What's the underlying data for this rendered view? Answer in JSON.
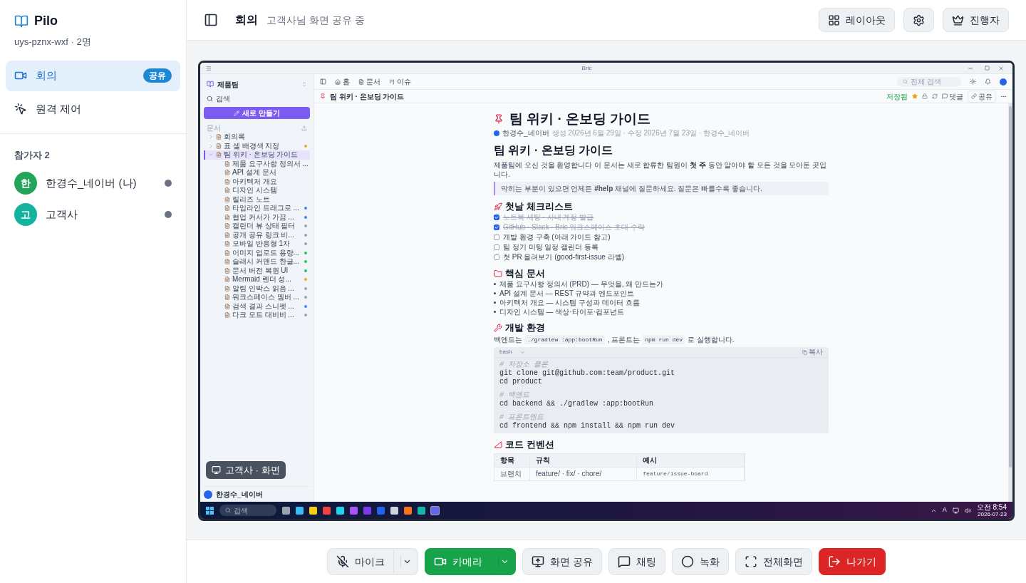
{
  "app": {
    "name": "Pilo",
    "room": "uys-pznx-wxf · 2명"
  },
  "nav": [
    {
      "kind": "meeting",
      "label": "회의",
      "selected": true,
      "badge": "공유"
    },
    {
      "kind": "remote",
      "label": "원격 제어",
      "selected": false
    }
  ],
  "participants": {
    "title": "참가자 2",
    "items": [
      {
        "initial": "한",
        "name": "한경수_네이버 (나)",
        "color": "#22a55a"
      },
      {
        "initial": "고",
        "name": "고객사",
        "color": "#14b3a0"
      }
    ]
  },
  "header": {
    "title": "회의",
    "subtitle": "고객사님 화면 공유 중",
    "buttons": [
      {
        "kind": "layout",
        "label": "레이아웃"
      },
      {
        "kind": "settings"
      },
      {
        "kind": "host",
        "label": "진행자"
      }
    ]
  },
  "share": {
    "label": "고객사 · 화면",
    "screen": {
      "window_title": "Bric",
      "toolbar": [
        {
          "kind": "home",
          "label": "홈"
        },
        {
          "kind": "docs",
          "label": "문서"
        },
        {
          "kind": "issues",
          "label": "이슈"
        }
      ],
      "search_placeholder": "전체 검색",
      "doc_header": {
        "title": "팀 위키 · 온보딩 가이드",
        "status": "저장됨",
        "comment": "댓글",
        "share": "공유"
      },
      "sidebar": {
        "workspace": "제품팀",
        "search": "검색",
        "new_button": "새로 만들기",
        "section": "문서",
        "user": "한경수_네이버",
        "tree": [
          {
            "label": "회의록",
            "selected": false,
            "expanded": false
          },
          {
            "label": "표 셀 배경색 지정",
            "selected": false,
            "expanded": false,
            "color": "#f5a524"
          },
          {
            "label": "팀 위키 · 온보딩 가이드",
            "selected": true,
            "expanded": true,
            "children": [
              {
                "label": "제품 요구사항 정의서 ..."
              },
              {
                "label": "API 설계 문서"
              },
              {
                "label": "아키텍처 개요"
              },
              {
                "label": "디자인 시스템"
              },
              {
                "label": "릴리즈 노트"
              },
              {
                "label": "타임라인 드래그로 ...",
                "color": "#3b82f6"
              },
              {
                "label": "협업 커서가 가끔 ...",
                "color": "#3b82f6"
              },
              {
                "label": "캘린더 뷰 상태 필터",
                "color": "#9ca3af"
              },
              {
                "label": "공개 공유 링크 비...",
                "color": "#9ca3af"
              },
              {
                "label": "모바일 반응형 1차",
                "color": "#9ca3af"
              },
              {
                "label": "이미지 업로드 용량...",
                "color": "#22c55e"
              },
              {
                "label": "슬래시 커맨드 한글...",
                "color": "#22c55e"
              },
              {
                "label": "문서 버전 복원 UI",
                "color": "#22c55e"
              },
              {
                "label": "Mermaid 렌더 성...",
                "color": "#f5a524"
              },
              {
                "label": "알림 인박스 읽음 ...",
                "color": "#9ca3af"
              },
              {
                "label": "워크스페이스 멤버 ...",
                "color": "#9ca3af"
              },
              {
                "label": "검색 결과 스니펫 ...",
                "color": "#3b82f6"
              },
              {
                "label": "다크 모드 대비비 ...",
                "color": "#9ca3af"
              }
            ]
          }
        ]
      },
      "doc": {
        "title": "팀 위키 · 온보딩 가이드",
        "author": "한경수_네이버",
        "meta": "생성 2026년 6월 29일 · 수정 2026년 7월 23일 · 한경수_네이버",
        "blocks": [
          {
            "kind": "h1",
            "text": "팀 위키 · 온보딩 가이드"
          },
          {
            "kind": "p",
            "text": "제품팀에 오신 것을 환영합니다 이 문서는 새로 합류한 팀원이 **첫 주** 동안 알아야 할 모든 것을 모아둔 곳입니다."
          },
          {
            "kind": "callout",
            "text": "막히는 부분이 있으면 언제든 **#help** 채널에 질문하세요. 질문은 빠를수록 좋습니다."
          },
          {
            "kind": "h2",
            "text": "첫날 체크리스트"
          },
          {
            "kind": "todo",
            "text": "노트북 세팅 · 사내 계정 발급",
            "checked": true
          },
          {
            "kind": "todo",
            "text": "GitHub · Slack · Bric 워크스페이스 초대 수락",
            "checked": true
          },
          {
            "kind": "todo",
            "text": "개발 환경 구축 (아래 가이드 참고)",
            "checked": false
          },
          {
            "kind": "todo",
            "text": "팀 정기 미팅 일정 캘린더 등록",
            "checked": false
          },
          {
            "kind": "todo",
            "text": "첫 PR 올려보기 (good-first-issue 라벨)",
            "checked": false
          },
          {
            "kind": "h2",
            "text": "핵심 문서"
          },
          {
            "kind": "bullet",
            "text": "제품 요구사항 정의서 (PRD) — 무엇을, 왜 만드는가"
          },
          {
            "kind": "bullet",
            "text": "API 설계 문서 — REST 규약과 엔드포인트"
          },
          {
            "kind": "bullet",
            "text": "아키텍처 개요 — 시스템 구성과 데이터 흐름"
          },
          {
            "kind": "bullet",
            "text": "디자인 시스템 — 색상·타이포·컴포넌트"
          },
          {
            "kind": "h2",
            "text": "개발 환경"
          },
          {
            "kind": "p_code",
            "parts": [
              {
                "text": "백엔드는"
              },
              {
                "code": "./gradlew :app:bootRun"
              },
              {
                "text": ", 프론트는"
              },
              {
                "code": "npm run dev"
              },
              {
                "text": "로 실행합니다."
              }
            ]
          },
          {
            "kind": "code",
            "language": "bash",
            "copy": "복사",
            "lines": [
              {
                "kind": "comment",
                "text": "# 저장소 클론"
              },
              {
                "kind": "code",
                "text": "git clone git@github.com:team/product.git"
              },
              {
                "kind": "code",
                "text": "cd product"
              },
              {
                "kind": "gap"
              },
              {
                "kind": "comment",
                "text": "# 백엔드"
              },
              {
                "kind": "code",
                "text": "cd backend && ./gradlew :app:bootRun"
              },
              {
                "kind": "gap"
              },
              {
                "kind": "comment",
                "text": "# 프론트엔드"
              },
              {
                "kind": "code",
                "text": "cd frontend && npm install && npm run dev"
              }
            ]
          },
          {
            "kind": "h2",
            "text": "코드 컨벤션"
          },
          {
            "kind": "table",
            "columns": [
              "항목",
              "규칙",
              "예시"
            ],
            "rows": [
              [
                "브랜치",
                "feature/ · fix/ · chore/",
                "feature/issue-board"
              ]
            ]
          }
        ]
      },
      "taskbar": {
        "search": "검색",
        "apps": [
          {
            "color": "#9ca3af",
            "selected": false
          },
          {
            "color": "#38bdf8",
            "selected": false
          },
          {
            "color": "#facc15",
            "selected": false
          },
          {
            "color": "#ef4444",
            "selected": false
          },
          {
            "color": "#22d3ee",
            "selected": false
          },
          {
            "color": "#a855f7",
            "selected": false
          },
          {
            "color": "#7c3aed",
            "selected": false
          },
          {
            "color": "#2563eb",
            "selected": false
          },
          {
            "color": "#d1d5db",
            "selected": false
          },
          {
            "color": "#f97316",
            "selected": false
          },
          {
            "color": "#14b8a6",
            "selected": false
          },
          {
            "color": "#6366f1",
            "selected": true
          }
        ],
        "ime": "A",
        "time": "오전 8:54",
        "date": "2026-07-23"
      }
    }
  },
  "controls": [
    {
      "kind": "mic",
      "label": "마이크",
      "on": false,
      "menu": true
    },
    {
      "kind": "camera",
      "label": "카메라",
      "on": true,
      "menu": true
    },
    {
      "kind": "screen",
      "label": "화면 공유"
    },
    {
      "kind": "chat",
      "label": "채팅"
    },
    {
      "kind": "record",
      "label": "녹화"
    },
    {
      "kind": "fullscreen",
      "label": "전체화면"
    },
    {
      "kind": "leave",
      "label": "나가기"
    }
  ]
}
